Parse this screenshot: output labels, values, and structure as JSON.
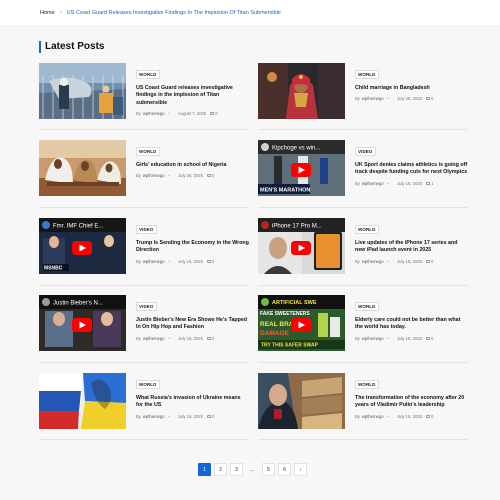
{
  "breadcrumb": {
    "home": "Home",
    "separator": "›",
    "current": "US Coast Guard Releases Investigative Findings In The Implosion Of Titan Submersible"
  },
  "section_title": "Latest Posts",
  "posts": [
    {
      "category": "WORLD",
      "title": "US Coast Guard releases investigative findings in the implosion of Titan submersible",
      "author": "wpthemego",
      "date": "August 7, 2025",
      "comments": "0",
      "thumb": "coast-guard"
    },
    {
      "category": "WORLD",
      "title": "Child marriage in Bangladesh",
      "author": "wpthemego",
      "date": "July 26, 2025",
      "comments": "0",
      "thumb": "bride"
    },
    {
      "category": "WORLD",
      "title": "Girls' education in school of Nigeria",
      "author": "wpthemego",
      "date": "July 26, 2025",
      "comments": "0",
      "thumb": "classroom"
    },
    {
      "category": "VIDEO",
      "title": "UK Sport denies claims athletics is going off track despite funding cuts for next Olympics",
      "author": "wpthemego",
      "date": "July 16, 2025",
      "comments": "1",
      "thumb": "marathon-video"
    },
    {
      "category": "VIDEO",
      "title": "Trump Is Sending the Economy in the Wrong Direction",
      "author": "wpthemego",
      "date": "July 16, 2025",
      "comments": "0",
      "thumb": "msnbc-video"
    },
    {
      "category": "WORLD",
      "title": "Live updates of the iPhone 17 series and new iPad launch event in 2025",
      "author": "wpthemego",
      "date": "July 16, 2025",
      "comments": "0",
      "thumb": "iphone-video"
    },
    {
      "category": "VIDEO",
      "title": "Justin Bieber's New Era Shows He's Tapped In On Hip Hop and Fashion",
      "author": "wpthemego",
      "date": "July 16, 2025",
      "comments": "0",
      "thumb": "bieber-video"
    },
    {
      "category": "WORLD",
      "title": "Elderly care could not be better than what the world has today.",
      "author": "wpthemego",
      "date": "July 16, 2025",
      "comments": "0",
      "thumb": "sweeteners-video"
    },
    {
      "category": "WORLD",
      "title": "What Russia's invasion of Ukraine means for the US",
      "author": "wpthemego",
      "date": "July 16, 2025",
      "comments": "0",
      "thumb": "flags"
    },
    {
      "category": "WORLD",
      "title": "The transformation of the economy after 20 years of Vladimir Putin's leadership",
      "author": "wpthemego",
      "date": "July 16, 2025",
      "comments": "0",
      "thumb": "putin"
    }
  ],
  "meta_prefix": "By",
  "video_texts": {
    "marathon_title": "Kipchoge vs win...",
    "marathon_banner": "MEN'S MARATHON",
    "msnbc_title": "Fmr. IMF Chief E...",
    "msnbc_logo": "MSNBC",
    "iphone_title": "iPhone 17 Pro M...",
    "bieber_title": "Justin Bieber's N...",
    "sweet_line1": "ARTIFICIAL SWE",
    "sweet_line2": "FAKE SWEETENERS",
    "sweet_line3": "REAL BRA",
    "sweet_line4": "DAMAGE",
    "sweet_line5": "TRY THIS SAFER SWAP"
  },
  "pagination": [
    "1",
    "2",
    "3",
    "...",
    "5",
    "6",
    "›"
  ],
  "pagination_active": "1",
  "colors": {
    "accent": "#1565d8",
    "youtube_red": "#ff0000"
  }
}
